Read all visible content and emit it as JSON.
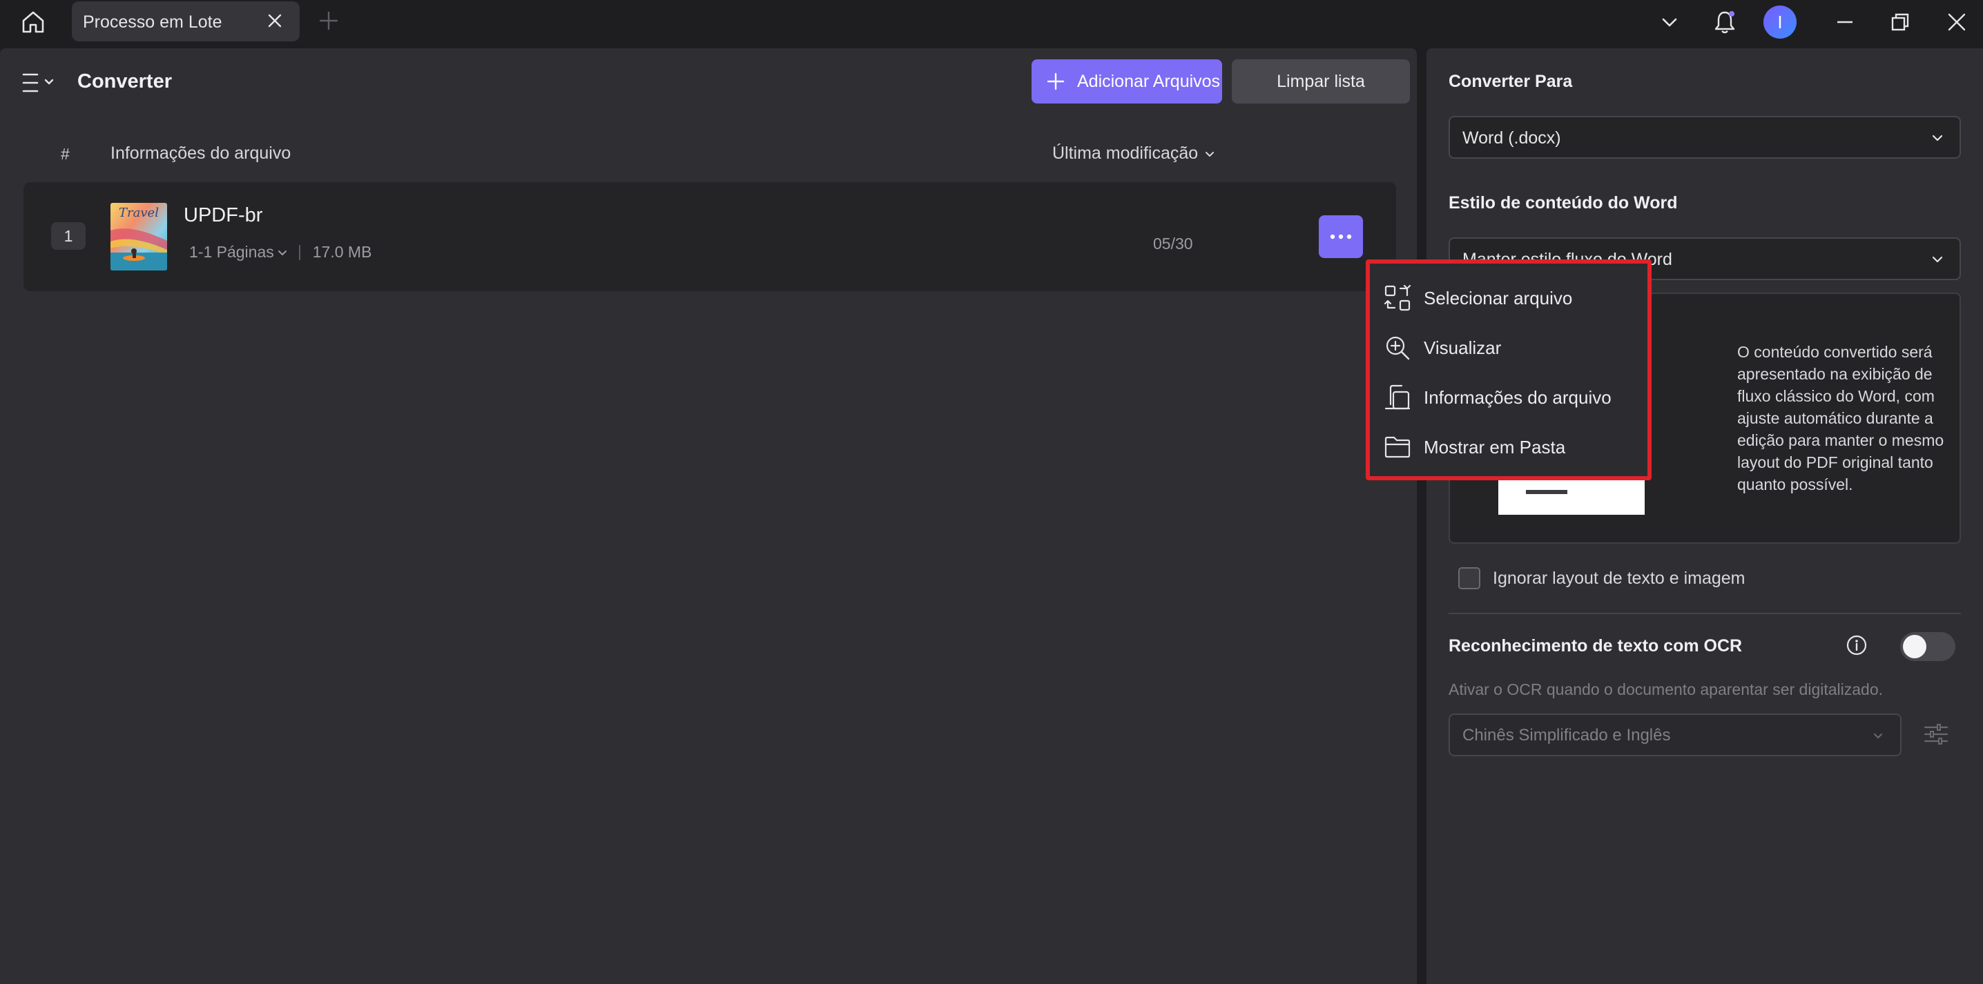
{
  "titlebar": {
    "tab_label": "Processo em Lote",
    "avatar_initial": "I"
  },
  "main": {
    "title": "Converter",
    "add_files_label": "Adicionar Arquivos",
    "clear_list_label": "Limpar lista",
    "columns": {
      "number": "#",
      "file_info": "Informações do arquivo",
      "last_modified": "Última modificação"
    },
    "files": [
      {
        "index": "1",
        "name": "UPDF-br",
        "pages": "1-1 Páginas",
        "size": "17.0 MB",
        "date": "05/30",
        "thumbnail_text": "Travel"
      }
    ]
  },
  "context_menu": {
    "items": [
      {
        "label": "Selecionar arquivo",
        "icon": "select-file-icon"
      },
      {
        "label": "Visualizar",
        "icon": "zoom-in-icon"
      },
      {
        "label": "Informações do arquivo",
        "icon": "file-info-icon"
      },
      {
        "label": "Mostrar em Pasta",
        "icon": "folder-icon"
      }
    ]
  },
  "side": {
    "convert_to_heading": "Converter Para",
    "convert_to_value": "Word (.docx)",
    "word_style_heading": "Estilo de conteúdo do Word",
    "word_style_value": "Manter estilo fluxo do Word",
    "preview_description": "O conteúdo convertido será apresentado na exibição de fluxo clássico do Word, com ajuste automático durante a edição para manter o mesmo layout do PDF original tanto quanto possível.",
    "ignore_layout_label": "Ignorar layout de texto e imagem",
    "ignore_layout_checked": false,
    "ocr_heading": "Reconhecimento de texto com OCR",
    "ocr_enabled": false,
    "ocr_hint": "Ativar o OCR quando o documento aparentar ser digitalizado.",
    "ocr_language": "Chinês Simplificado e Inglês"
  },
  "colors": {
    "accent": "#7d6cf6",
    "highlight_border": "#e0222a",
    "panel_bg": "#2f2f33",
    "app_bg": "#1e1e20"
  }
}
